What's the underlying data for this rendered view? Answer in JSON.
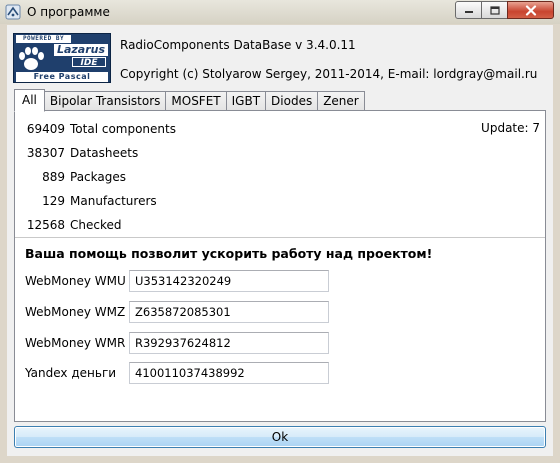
{
  "window": {
    "title": "О программе",
    "min_icon": "minimize-icon",
    "max_icon": "maximize-icon",
    "close_icon": "close-icon"
  },
  "logo": {
    "powered": "POWERED BY",
    "lazarus": "Lazarus",
    "ide": "IDE",
    "free_pascal": "Free Pascal"
  },
  "header": {
    "app_name": "RadioComponents DataBase v 3.4.0.11",
    "copyright": "Copyright (c) Stolyarow Sergey, 2011-2014,  E-mail: lordgray@mail.ru"
  },
  "tabs": [
    {
      "label": "All",
      "active": true
    },
    {
      "label": "Bipolar Transistors"
    },
    {
      "label": "MOSFET"
    },
    {
      "label": "IGBT"
    },
    {
      "label": "Diodes"
    },
    {
      "label": "Zener"
    }
  ],
  "stats": [
    {
      "value": "69409",
      "label": "Total components"
    },
    {
      "value": "38307",
      "label": "Datasheets"
    },
    {
      "value": "889",
      "label": "Packages"
    },
    {
      "value": "129",
      "label": "Manufacturers"
    },
    {
      "value": "12568",
      "label": "Checked"
    }
  ],
  "update": "Update: 7",
  "help_text": "Ваша помощь позволит ускорить работу над проектом!",
  "payments": [
    {
      "label": "WebMoney WMU",
      "value": "U353142320249"
    },
    {
      "label": "WebMoney WMZ",
      "value": "Z635872085301"
    },
    {
      "label": "WebMoney WMR",
      "value": "R392937624812"
    },
    {
      "label": "Yandex деньги",
      "value": "410011037438992"
    }
  ],
  "ok_label": "Ok",
  "colors": {
    "logo_bg": "#1f3f6c",
    "button_border": "#3c7fb1"
  }
}
